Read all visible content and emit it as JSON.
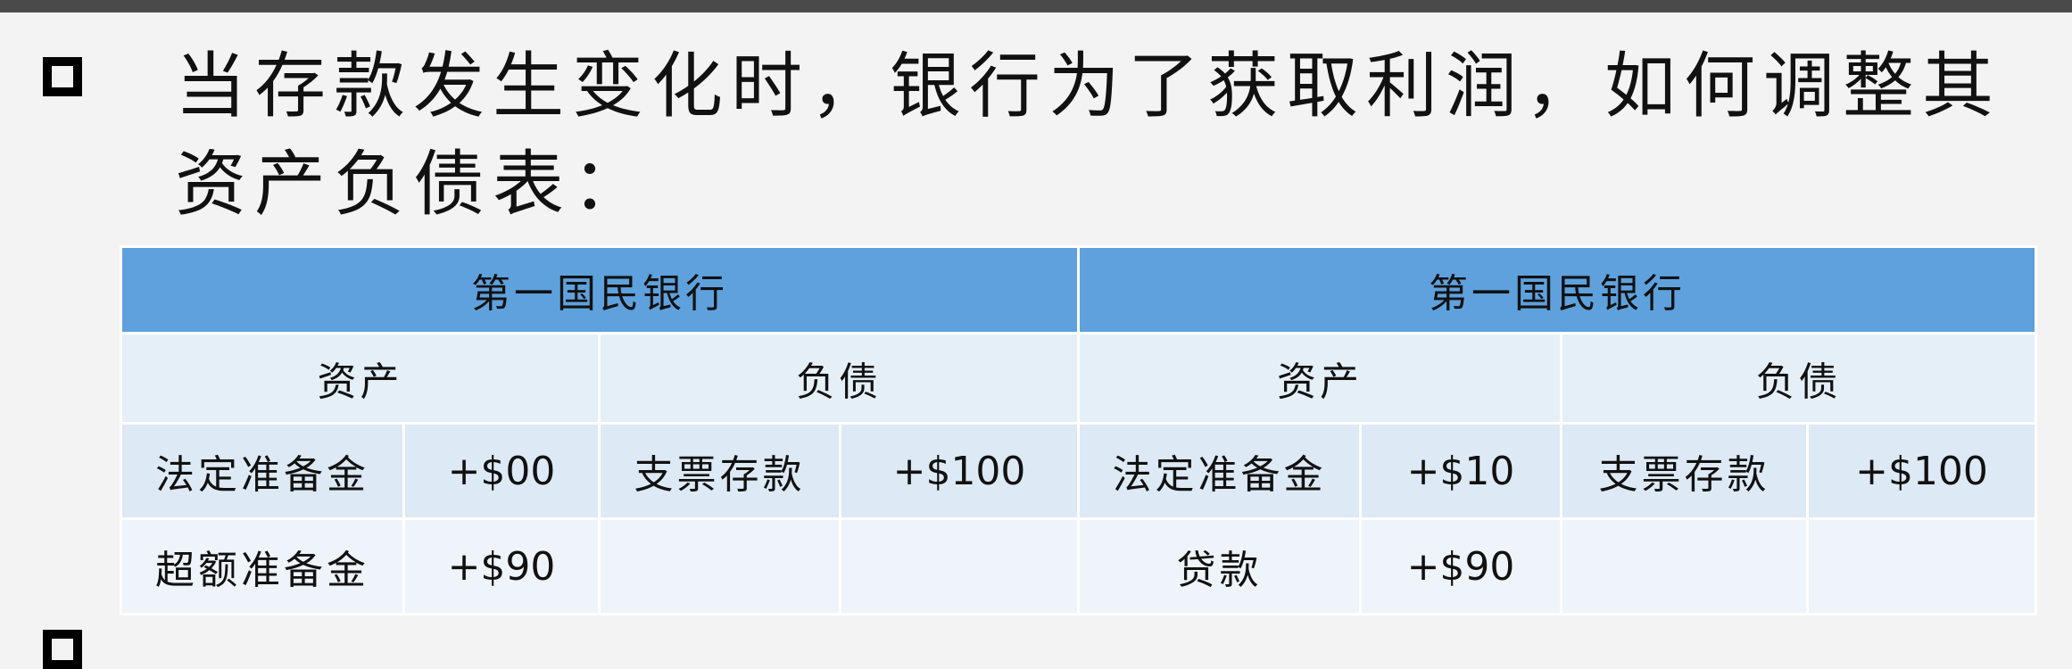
{
  "heading": "当存款发生变化时，银行为了获取利润，如何调整其资产负债表：",
  "table": {
    "banks": [
      "第一国民银行",
      "第一国民银行"
    ],
    "sides": [
      "资产",
      "负债",
      "资产",
      "负债"
    ],
    "rows": [
      [
        "法定准备金",
        "+$00",
        "支票存款",
        "+$100",
        "法定准备金",
        "+$10",
        "支票存款",
        "+$100"
      ],
      [
        "超额准备金",
        "+$90",
        "",
        "",
        "贷款",
        "+$90",
        "",
        ""
      ]
    ]
  }
}
